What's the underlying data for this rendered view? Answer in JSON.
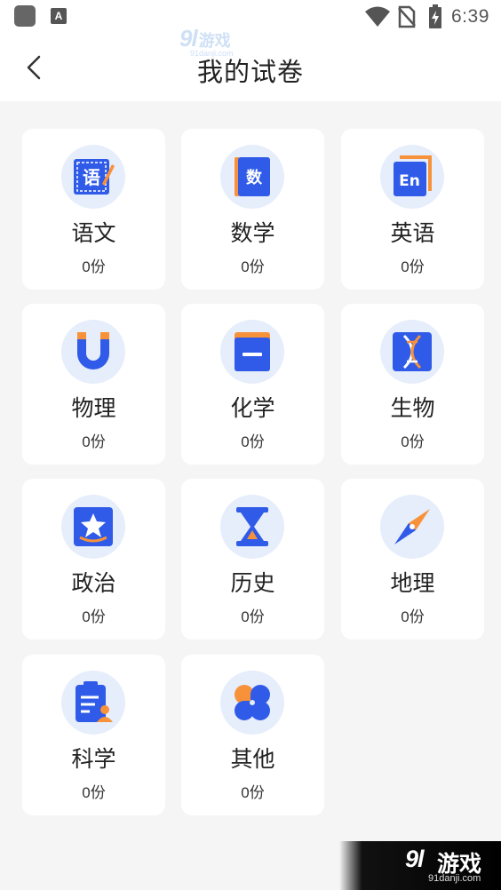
{
  "status_bar": {
    "time": "6:39",
    "app_icon_letter": "A"
  },
  "header": {
    "title": "我的试卷",
    "back_icon": "chevron-left-icon"
  },
  "watermark": {
    "brand": "9l",
    "brand_cn": "游戏",
    "url": "91danji.com"
  },
  "colors": {
    "accent_blue": "#2f5be8",
    "accent_orange": "#f7923a",
    "icon_bg": "#e6edfb",
    "card_bg": "#ffffff",
    "page_bg": "#f5f5f5"
  },
  "subjects": [
    {
      "name": "语文",
      "count": "0份",
      "icon": "chinese-book-icon"
    },
    {
      "name": "数学",
      "count": "0份",
      "icon": "math-book-icon"
    },
    {
      "name": "英语",
      "count": "0份",
      "icon": "english-book-icon"
    },
    {
      "name": "物理",
      "count": "0份",
      "icon": "magnet-icon"
    },
    {
      "name": "化学",
      "count": "0份",
      "icon": "chemistry-book-icon"
    },
    {
      "name": "生物",
      "count": "0份",
      "icon": "dna-icon"
    },
    {
      "name": "政治",
      "count": "0份",
      "icon": "star-badge-icon"
    },
    {
      "name": "历史",
      "count": "0份",
      "icon": "hourglass-icon"
    },
    {
      "name": "地理",
      "count": "0份",
      "icon": "compass-icon"
    },
    {
      "name": "科学",
      "count": "0份",
      "icon": "clipboard-person-icon"
    },
    {
      "name": "其他",
      "count": "0份",
      "icon": "clover-icon"
    }
  ]
}
